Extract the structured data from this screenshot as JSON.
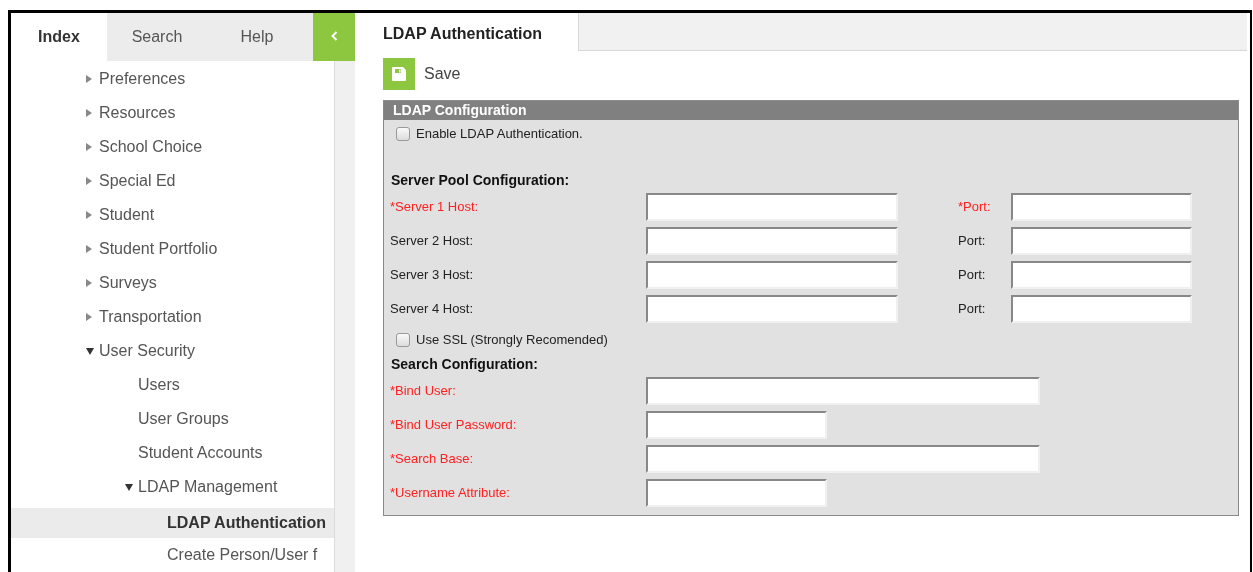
{
  "sidebar": {
    "tabs": [
      {
        "label": "Index",
        "selected": true
      },
      {
        "label": "Search",
        "selected": false
      },
      {
        "label": "Help",
        "selected": false
      }
    ],
    "tree": [
      {
        "label": "Preferences",
        "expanded": false,
        "selected": false
      },
      {
        "label": "Resources",
        "expanded": false,
        "selected": false
      },
      {
        "label": "School Choice",
        "expanded": false,
        "selected": false
      },
      {
        "label": "Special Ed",
        "expanded": false,
        "selected": false
      },
      {
        "label": "Student",
        "expanded": false,
        "selected": false
      },
      {
        "label": "Student Portfolio",
        "expanded": false,
        "selected": false
      },
      {
        "label": "Surveys",
        "expanded": false,
        "selected": false
      },
      {
        "label": "Transportation",
        "expanded": false,
        "selected": false
      },
      {
        "label": "User Security",
        "expanded": true,
        "selected": false,
        "children": [
          {
            "label": "Users",
            "selected": false
          },
          {
            "label": "User Groups",
            "selected": false
          },
          {
            "label": "Student Accounts",
            "selected": false
          },
          {
            "label": "LDAP Management",
            "expanded": true,
            "selected": false,
            "children": [
              {
                "label": "LDAP Authentication",
                "selected": true
              },
              {
                "label": "Create Person/User f",
                "selected": false
              }
            ]
          }
        ]
      }
    ]
  },
  "main": {
    "tab": "LDAP Authentication",
    "save": "Save",
    "panel": {
      "title": "LDAP Configuration",
      "items": [
        {
          "kind": "checkbox",
          "label": "Enable LDAP Authentication.",
          "checked": false
        },
        {
          "kind": "heading",
          "text": "Server Pool Configuration:"
        },
        {
          "kind": "server",
          "label": "*Server 1 Host:",
          "required": true,
          "port_label": "*Port:",
          "port_required": true
        },
        {
          "kind": "server",
          "label": "Server 2 Host:",
          "required": false,
          "port_label": "Port:",
          "port_required": false
        },
        {
          "kind": "server",
          "label": "Server 3 Host:",
          "required": false,
          "port_label": "Port:",
          "port_required": false
        },
        {
          "kind": "server",
          "label": "Server 4 Host:",
          "required": false,
          "port_label": "Port:",
          "port_required": false
        },
        {
          "kind": "checkbox",
          "label": "Use SSL (Strongly Recomended)",
          "checked": false
        },
        {
          "kind": "heading",
          "text": "Search Configuration:"
        },
        {
          "kind": "long-field",
          "label": "*Bind User:",
          "required": true
        },
        {
          "kind": "short-field",
          "label": "*Bind User Password:",
          "required": true
        },
        {
          "kind": "long-field",
          "label": "*Search Base:",
          "required": true
        },
        {
          "kind": "short-field",
          "label": "*Username Attribute:",
          "required": true
        }
      ]
    }
  }
}
